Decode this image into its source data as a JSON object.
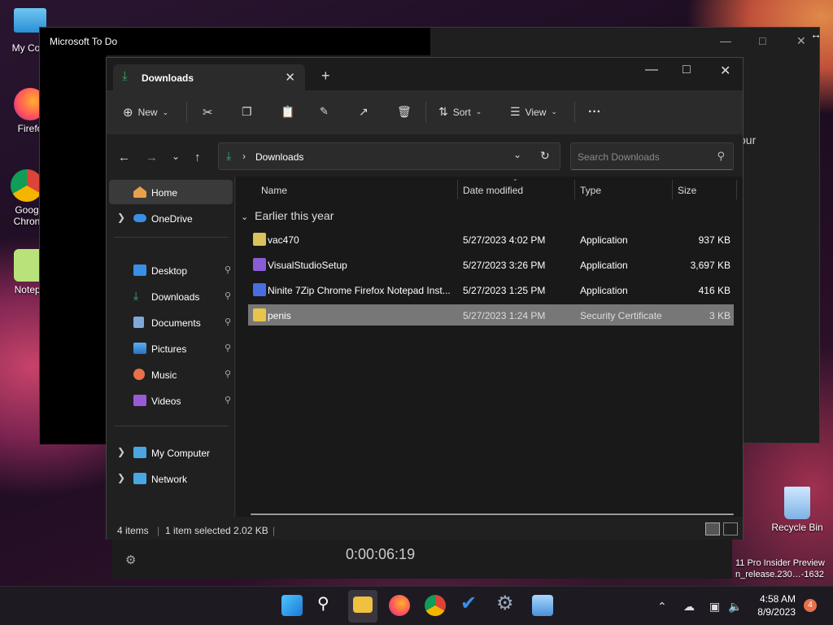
{
  "desktop": {
    "icons": [
      {
        "label": "My Com"
      },
      {
        "label": "Firefo"
      },
      {
        "label": "Goog Chron"
      },
      {
        "label": "Notepa"
      }
    ],
    "recycle_bin": "Recycle Bin",
    "watermark_line1": "11 Pro Insider Preview",
    "watermark_line2": "n_release.230…-1632"
  },
  "todo_window": {
    "title": "Microsoft To Do",
    "timer": "0:00:06:19",
    "partial_right": "our"
  },
  "explorer": {
    "tab_title": "Downloads",
    "toolbar": {
      "new_label": "New",
      "sort_label": "Sort",
      "view_label": "View",
      "more_label": "···"
    },
    "address": {
      "path": "Downloads",
      "search_placeholder": "Search Downloads"
    },
    "nav": {
      "home": "Home",
      "onedrive": "OneDrive",
      "quick": [
        {
          "label": "Desktop"
        },
        {
          "label": "Downloads"
        },
        {
          "label": "Documents"
        },
        {
          "label": "Pictures"
        },
        {
          "label": "Music"
        },
        {
          "label": "Videos"
        }
      ],
      "my_computer": "My Computer",
      "network": "Network"
    },
    "columns": {
      "name": "Name",
      "date": "Date modified",
      "type": "Type",
      "size": "Size"
    },
    "group": "Earlier this year",
    "files": [
      {
        "name": "vac470",
        "date": "5/27/2023 4:02 PM",
        "type": "Application",
        "size": "937 KB",
        "color": "#d9c35a"
      },
      {
        "name": "VisualStudioSetup",
        "date": "5/27/2023 3:26 PM",
        "type": "Application",
        "size": "3,697 KB",
        "color": "#8a5cd6"
      },
      {
        "name": "Ninite 7Zip Chrome Firefox Notepad Inst...",
        "date": "5/27/2023 1:25 PM",
        "type": "Application",
        "size": "416 KB",
        "color": "#4a6ee0"
      },
      {
        "name": "penis",
        "date": "5/27/2023 1:24 PM",
        "type": "Security Certificate",
        "size": "3 KB",
        "color": "#e8c44a"
      }
    ],
    "status": {
      "items": "4 items",
      "selected": "1 item selected  2.02 KB"
    }
  },
  "taskbar": {
    "time": "4:58 AM",
    "date": "8/9/2023",
    "badge": "4"
  },
  "colors": {
    "accent_green": "#2fb36a",
    "selected_row": "#777777",
    "folder_blue": "#3a8ee6"
  }
}
